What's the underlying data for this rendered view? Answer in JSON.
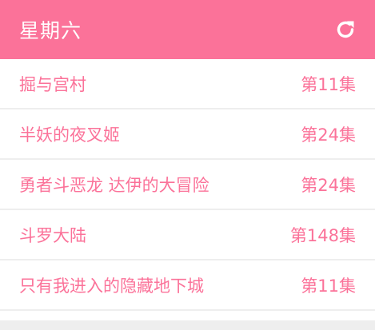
{
  "header": {
    "title": "星期六",
    "refresh_icon": "refresh-icon"
  },
  "colors": {
    "accent": "#fb7299",
    "background": "#eeeeee",
    "row_background": "#ffffff"
  },
  "items": [
    {
      "name": "掘与宫村",
      "episode": "第11集"
    },
    {
      "name": "半妖的夜叉姬",
      "episode": "第24集"
    },
    {
      "name": "勇者斗恶龙 达伊的大冒险",
      "episode": "第24集"
    },
    {
      "name": "斗罗大陆",
      "episode": "第148集"
    },
    {
      "name": "只有我进入的隐藏地下城",
      "episode": "第11集"
    }
  ]
}
